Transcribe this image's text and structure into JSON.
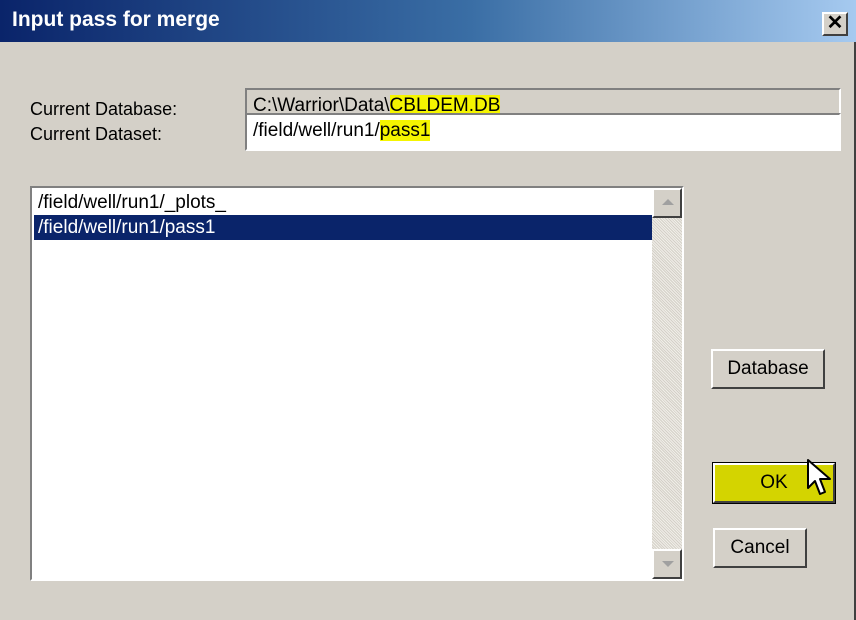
{
  "window": {
    "title": "Input pass for merge",
    "close_glyph": "✕"
  },
  "fields": {
    "database_label": "Current Database:",
    "database_prefix": "C:\\Warrior\\Data\\",
    "database_highlight": "CBLDEM.DB",
    "dataset_label": "Current Dataset:",
    "dataset_prefix": "/field/well/run1/",
    "dataset_highlight": "pass1"
  },
  "list": {
    "items": [
      {
        "label": "/field/well/run1/_plots_",
        "selected": false
      },
      {
        "label": "/field/well/run1/pass1",
        "selected": true
      }
    ]
  },
  "buttons": {
    "database_label": "Database",
    "ok_label": "OK",
    "cancel_label": "Cancel"
  },
  "colors": {
    "title_bar": "#0a246a",
    "highlight": "#f5f500",
    "selection": "#0a246a",
    "ok_button": "#d4d400"
  },
  "icons": {
    "close": "close-icon",
    "scroll_up": "arrow-up-icon",
    "scroll_down": "arrow-down-icon",
    "pointer": "mouse-cursor-icon"
  }
}
